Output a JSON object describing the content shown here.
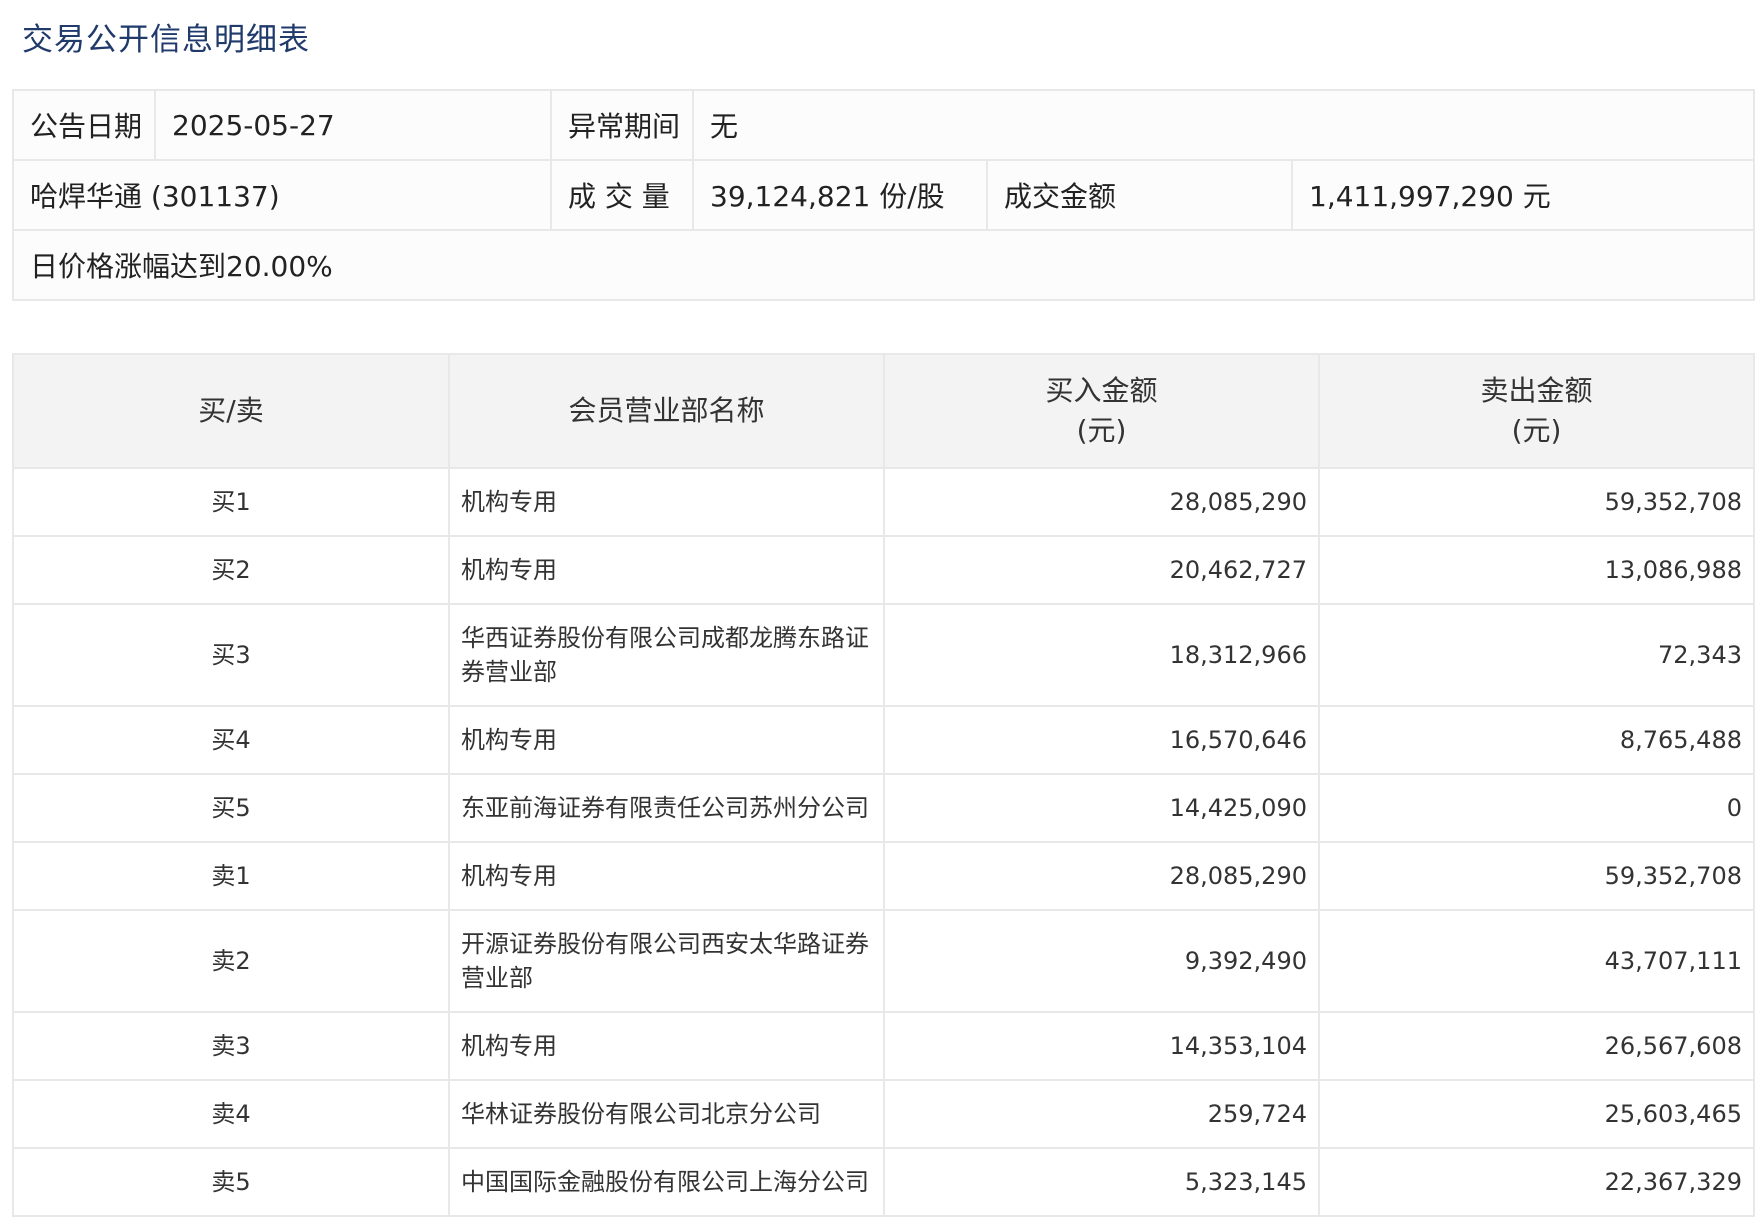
{
  "page": {
    "title": "交易公开信息明细表"
  },
  "info": {
    "announce_date_label": "公告日期",
    "announce_date_value": "2025-05-27",
    "abnormal_period_label": "异常期间",
    "abnormal_period_value": "无",
    "stock_name": "哈焊华通 (301137)",
    "volume_label": "成 交 量",
    "volume_value": "39,124,821 份/股",
    "turnover_label": "成交金额",
    "turnover_value": "1,411,997,290 元",
    "reason": "日价格涨幅达到20.00%"
  },
  "detail": {
    "headers": {
      "side": "买/卖",
      "branch": "会员营业部名称",
      "buy_amount": "买入金额",
      "buy_unit": "(元)",
      "sell_amount": "卖出金额",
      "sell_unit": "(元)"
    },
    "rows": [
      {
        "side": "买1",
        "branch": "机构专用",
        "buy": "28,085,290",
        "sell": "59,352,708"
      },
      {
        "side": "买2",
        "branch": "机构专用",
        "buy": "20,462,727",
        "sell": "13,086,988"
      },
      {
        "side": "买3",
        "branch": "华西证券股份有限公司成都龙腾东路证券营业部",
        "buy": "18,312,966",
        "sell": "72,343"
      },
      {
        "side": "买4",
        "branch": "机构专用",
        "buy": "16,570,646",
        "sell": "8,765,488"
      },
      {
        "side": "买5",
        "branch": "东亚前海证券有限责任公司苏州分公司",
        "buy": "14,425,090",
        "sell": "0"
      },
      {
        "side": "卖1",
        "branch": "机构专用",
        "buy": "28,085,290",
        "sell": "59,352,708"
      },
      {
        "side": "卖2",
        "branch": "开源证券股份有限公司西安太华路证券营业部",
        "buy": "9,392,490",
        "sell": "43,707,111"
      },
      {
        "side": "卖3",
        "branch": "机构专用",
        "buy": "14,353,104",
        "sell": "26,567,608"
      },
      {
        "side": "卖4",
        "branch": "华林证券股份有限公司北京分公司",
        "buy": "259,724",
        "sell": "25,603,465"
      },
      {
        "side": "卖5",
        "branch": "中国国际金融股份有限公司上海分公司",
        "buy": "5,323,145",
        "sell": "22,367,329"
      }
    ]
  }
}
